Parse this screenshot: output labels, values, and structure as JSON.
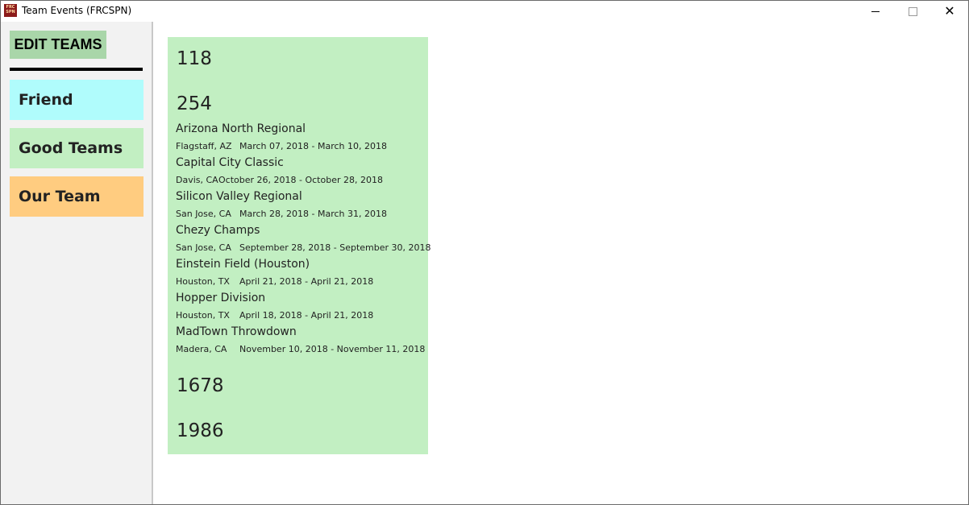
{
  "window": {
    "title": "Team Events (FRCSPN)",
    "icon_label": [
      "FRC",
      "SPN"
    ],
    "minimize_icon": "minimize-icon",
    "maximize_icon": "maximize-icon",
    "close_icon": "close-icon",
    "close_glyph": "✕"
  },
  "sidebar": {
    "edit_label": "EDIT TEAMS",
    "groups": [
      {
        "label": "Friend",
        "color": "#b0fcfc"
      },
      {
        "label": "Good Teams",
        "color": "#c2efc2"
      },
      {
        "label": "Our Team",
        "color": "#ffcc80"
      }
    ]
  },
  "panel": {
    "color": "#c2efc2",
    "teams": [
      "118",
      "254",
      "1678",
      "1986"
    ],
    "events": [
      {
        "name": "Arizona North Regional",
        "location": "Flagstaff, AZ",
        "dates": "March 07, 2018 - March 10, 2018"
      },
      {
        "name": "Capital City Classic",
        "location": "Davis, CA",
        "dates": "October 26, 2018 - October 28, 2018"
      },
      {
        "name": "Silicon Valley Regional",
        "location": "San Jose, CA",
        "dates": "March 28, 2018 - March 31, 2018"
      },
      {
        "name": "Chezy Champs",
        "location": "San Jose, CA",
        "dates": "September 28, 2018 - September 30, 2018"
      },
      {
        "name": "Einstein Field (Houston)",
        "location": "Houston, TX",
        "dates": "April 21, 2018 - April 21, 2018"
      },
      {
        "name": "Hopper Division",
        "location": "Houston, TX",
        "dates": "April 18, 2018 - April 21, 2018"
      },
      {
        "name": "MadTown Throwdown",
        "location": "Madera, CA",
        "dates": "November 10, 2018 - November 11, 2018"
      }
    ]
  }
}
